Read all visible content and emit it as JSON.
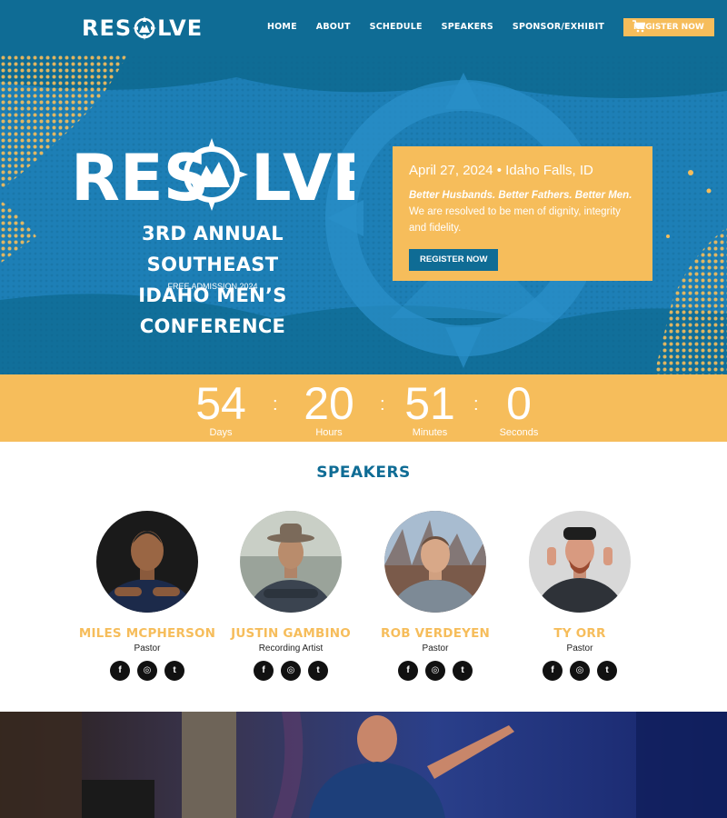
{
  "nav": {
    "logo_left": "RES",
    "logo_right": "LVE",
    "links": [
      "HOME",
      "ABOUT",
      "SCHEDULE",
      "SPEAKERS",
      "SPONSOR/EXHIBIT"
    ],
    "register": "REGISTER NOW",
    "cart_icon": "cart-icon"
  },
  "hero": {
    "logo_left": "RES",
    "logo_right": "LVE",
    "subtitle_line1": "3RD ANNUAL SOUTHEAST",
    "subtitle_line2": "IDAHO MEN’S CONFERENCE",
    "free": "FREE ADMISSION 2024",
    "card": {
      "date": "April 27, 2024 • Idaho Falls, ID",
      "tagline": "Better Husbands. Better Fathers. Better Men.",
      "description": "We are resolved to be men of dignity, integrity and fidelity.",
      "button": "REGISTER NOW"
    }
  },
  "countdown": {
    "units": [
      {
        "value": "54",
        "label": "Days"
      },
      {
        "value": "20",
        "label": "Hours"
      },
      {
        "value": "51",
        "label": "Minutes"
      },
      {
        "value": "0",
        "label": "Seconds"
      }
    ],
    "separator": ":"
  },
  "speakers": {
    "title": "SPEAKERS",
    "items": [
      {
        "name": "MILES MCPHERSON",
        "role": "Pastor"
      },
      {
        "name": "JUSTIN GAMBINO",
        "role": "Recording Artist"
      },
      {
        "name": "ROB VERDEYEN",
        "role": "Pastor"
      },
      {
        "name": "TY ORR",
        "role": "Pastor"
      }
    ],
    "social_icons": [
      "facebook-icon",
      "instagram-icon",
      "twitter-icon"
    ],
    "social_glyphs": [
      "f",
      "◎",
      "t"
    ]
  },
  "colors": {
    "brand_blue": "#0f6c95",
    "hero_blue": "#1d7fb6",
    "accent_gold": "#f6bd5b"
  }
}
